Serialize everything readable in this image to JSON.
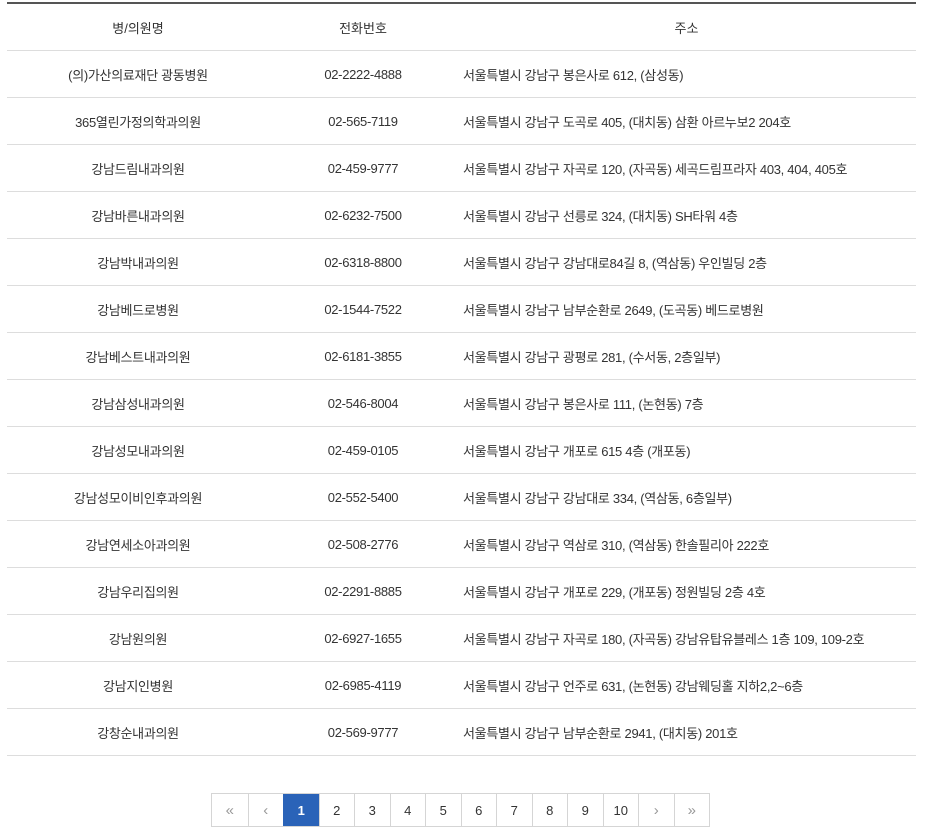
{
  "table": {
    "headers": {
      "name": "병/의원명",
      "phone": "전화번호",
      "address": "주소"
    },
    "rows": [
      {
        "name": "(의)가산의료재단 광동병원",
        "phone": "02-2222-4888",
        "address": "서울특별시 강남구 봉은사로 612, (삼성동)"
      },
      {
        "name": "365열린가정의학과의원",
        "phone": "02-565-7119",
        "address": "서울특별시 강남구 도곡로 405, (대치동) 삼환 아르누보2 204호"
      },
      {
        "name": "강남드림내과의원",
        "phone": "02-459-9777",
        "address": "서울특별시 강남구 자곡로 120, (자곡동) 세곡드림프라자 403, 404, 405호"
      },
      {
        "name": "강남바른내과의원",
        "phone": "02-6232-7500",
        "address": "서울특별시 강남구 선릉로 324, (대치동) SH타워 4층"
      },
      {
        "name": "강남박내과의원",
        "phone": "02-6318-8800",
        "address": "서울특별시 강남구 강남대로84길 8, (역삼동) 우인빌딩 2층"
      },
      {
        "name": "강남베드로병원",
        "phone": "02-1544-7522",
        "address": "서울특별시 강남구 남부순환로 2649, (도곡동) 베드로병원"
      },
      {
        "name": "강남베스트내과의원",
        "phone": "02-6181-3855",
        "address": "서울특별시 강남구 광평로 281, (수서동, 2층일부)"
      },
      {
        "name": "강남삼성내과의원",
        "phone": "02-546-8004",
        "address": "서울특별시 강남구 봉은사로 111, (논현동) 7층"
      },
      {
        "name": "강남성모내과의원",
        "phone": "02-459-0105",
        "address": "서울특별시 강남구 개포로 615 4층 (개포동)"
      },
      {
        "name": "강남성모이비인후과의원",
        "phone": "02-552-5400",
        "address": "서울특별시 강남구 강남대로 334, (역삼동, 6층일부)"
      },
      {
        "name": "강남연세소아과의원",
        "phone": "02-508-2776",
        "address": "서울특별시 강남구 역삼로 310, (역삼동) 한솔필리아 222호"
      },
      {
        "name": "강남우리집의원",
        "phone": "02-2291-8885",
        "address": "서울특별시 강남구 개포로 229, (개포동) 정원빌딩 2층 4호"
      },
      {
        "name": "강남원의원",
        "phone": "02-6927-1655",
        "address": "서울특별시 강남구 자곡로 180, (자곡동) 강남유탑유블레스 1층 109, 109-2호"
      },
      {
        "name": "강남지인병원",
        "phone": "02-6985-4119",
        "address": "서울특별시 강남구 언주로 631, (논현동) 강남웨딩홀 지하2,2~6층"
      },
      {
        "name": "강창순내과의원",
        "phone": "02-569-9777",
        "address": "서울특별시 강남구 남부순환로 2941, (대치동) 201호"
      }
    ]
  },
  "pagination": {
    "first_label": "«",
    "prev_label": "‹",
    "pages": [
      "1",
      "2",
      "3",
      "4",
      "5",
      "6",
      "7",
      "8",
      "9",
      "10"
    ],
    "current_page": "1",
    "next_label": "›",
    "last_label": "»",
    "active_color": "#2a63b8"
  }
}
